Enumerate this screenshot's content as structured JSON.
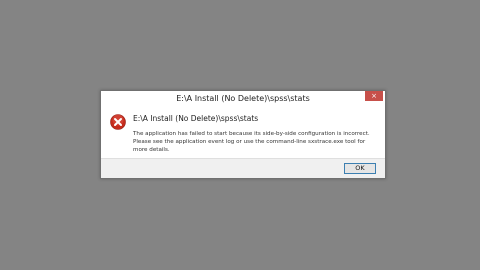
{
  "dialog": {
    "title": "E:\\A Install (No Delete)\\spss\\stats",
    "close_symbol": "×",
    "heading": "E:\\A Install (No Delete)\\spss\\stats",
    "message": "The application has failed to start because its side-by-side configuration is incorrect. Please see the application event log or use the command-line sxstrace.exe tool for more details.",
    "ok_label": "OK",
    "icon": "error-icon"
  },
  "colors": {
    "desktop": "#848484",
    "close_button": "#c7504a",
    "error_icon": "#c42b1c",
    "ok_border": "#3c7fb1"
  }
}
